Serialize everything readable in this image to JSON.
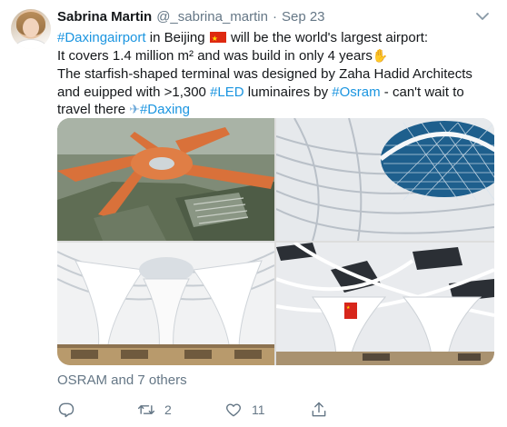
{
  "author": {
    "name": "Sabrina Martin",
    "handle": "@_sabrina_martin",
    "separator": "·",
    "date": "Sep 23"
  },
  "tweet": {
    "line1": {
      "hashtag": "#Daxingairport",
      "rest": " in Beijing",
      "after_flag": " will be the world's largest airport:"
    },
    "line2": "It covers 1.4 million m² and was build in only 4 years",
    "line3": "The starfish-shaped terminal was designed by Zaha Hadid Architects",
    "line4": {
      "pre": "and euipped with >1,300 ",
      "hashtag": "#LED",
      "mid": " luminaires by ",
      "mention": "#Osram",
      "post": " - can't wait to"
    },
    "line5": {
      "pre": "travel there ",
      "hashtag": "#Daxing"
    }
  },
  "icons": {
    "flag": "china-flag-icon",
    "clap": "clapping-hands-icon",
    "plane": "airplane-icon",
    "menu": "chevron-down-icon",
    "reply": "reply-icon",
    "retweet": "retweet-icon",
    "like": "heart-icon",
    "share": "share-icon"
  },
  "media": {
    "images": [
      "aerial-view-of-starfish-terminal",
      "terminal-roof-skylight",
      "terminal-interior-columns",
      "terminal-interior-with-flag"
    ]
  },
  "liked_by": "OSRAM and 7 others",
  "actions": {
    "reply_count": "",
    "retweet_count": "2",
    "like_count": "11",
    "share_count": ""
  },
  "colors": {
    "link": "#1b95e0",
    "secondary": "#657786",
    "text": "#14171a",
    "roof_orange": "#d9713a"
  }
}
